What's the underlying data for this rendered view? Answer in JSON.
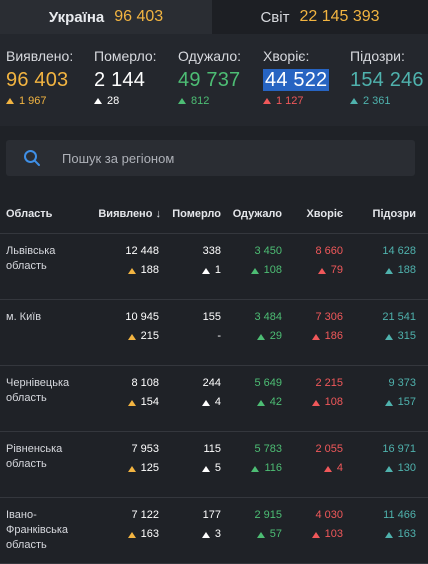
{
  "tabs": [
    {
      "name": "Україна",
      "count": "96 403"
    },
    {
      "name": "Світ",
      "count": "22 145 393"
    }
  ],
  "stats": [
    {
      "label": "Виявлено:",
      "value": "96 403",
      "delta": "1 967",
      "color": "yellow"
    },
    {
      "label": "Померло:",
      "value": "2 144",
      "delta": "28",
      "color": "white"
    },
    {
      "label": "Одужало:",
      "value": "49 737",
      "delta": "812",
      "color": "green"
    },
    {
      "label": "Хворіє:",
      "value": "44 522",
      "delta": "1 127",
      "color": "red"
    },
    {
      "label": "Підозри:",
      "value": "154 246",
      "delta": "2 361",
      "color": "teal"
    }
  ],
  "search": {
    "placeholder": "Пошук за регіоном"
  },
  "table": {
    "headers": {
      "region": "Область",
      "confirmed": "Виявлено",
      "deaths": "Померло",
      "recovered": "Одужало",
      "sick": "Хворіє",
      "suspected": "Підозри"
    },
    "rows": [
      {
        "region": "Львівська область",
        "confirmed": "12 448",
        "confirmed_delta": "188",
        "deaths": "338",
        "deaths_delta": "1",
        "recovered": "3 450",
        "recovered_delta": "108",
        "sick": "8 660",
        "sick_delta": "79",
        "suspected": "14 628",
        "suspected_delta": "188"
      },
      {
        "region": "м. Київ",
        "confirmed": "10 945",
        "confirmed_delta": "215",
        "deaths": "155",
        "deaths_delta": "-",
        "recovered": "3 484",
        "recovered_delta": "29",
        "sick": "7 306",
        "sick_delta": "186",
        "suspected": "21 541",
        "suspected_delta": "315"
      },
      {
        "region": "Чернівецька область",
        "confirmed": "8 108",
        "confirmed_delta": "154",
        "deaths": "244",
        "deaths_delta": "4",
        "recovered": "5 649",
        "recovered_delta": "42",
        "sick": "2 215",
        "sick_delta": "108",
        "suspected": "9 373",
        "suspected_delta": "157"
      },
      {
        "region": "Рівненська область",
        "confirmed": "7 953",
        "confirmed_delta": "125",
        "deaths": "115",
        "deaths_delta": "5",
        "recovered": "5 783",
        "recovered_delta": "116",
        "sick": "2 055",
        "sick_delta": "4",
        "suspected": "16 971",
        "suspected_delta": "130"
      },
      {
        "region": "Івано-Франківська область",
        "confirmed": "7 122",
        "confirmed_delta": "163",
        "deaths": "177",
        "deaths_delta": "3",
        "recovered": "2 915",
        "recovered_delta": "57",
        "sick": "4 030",
        "sick_delta": "103",
        "suspected": "11 466",
        "suspected_delta": "163"
      }
    ]
  },
  "colors": {
    "yellow": "#f2b441",
    "green": "#4dbd74",
    "red": "#f0585a",
    "teal": "#4fb2ad",
    "highlight": "#2764c2"
  }
}
